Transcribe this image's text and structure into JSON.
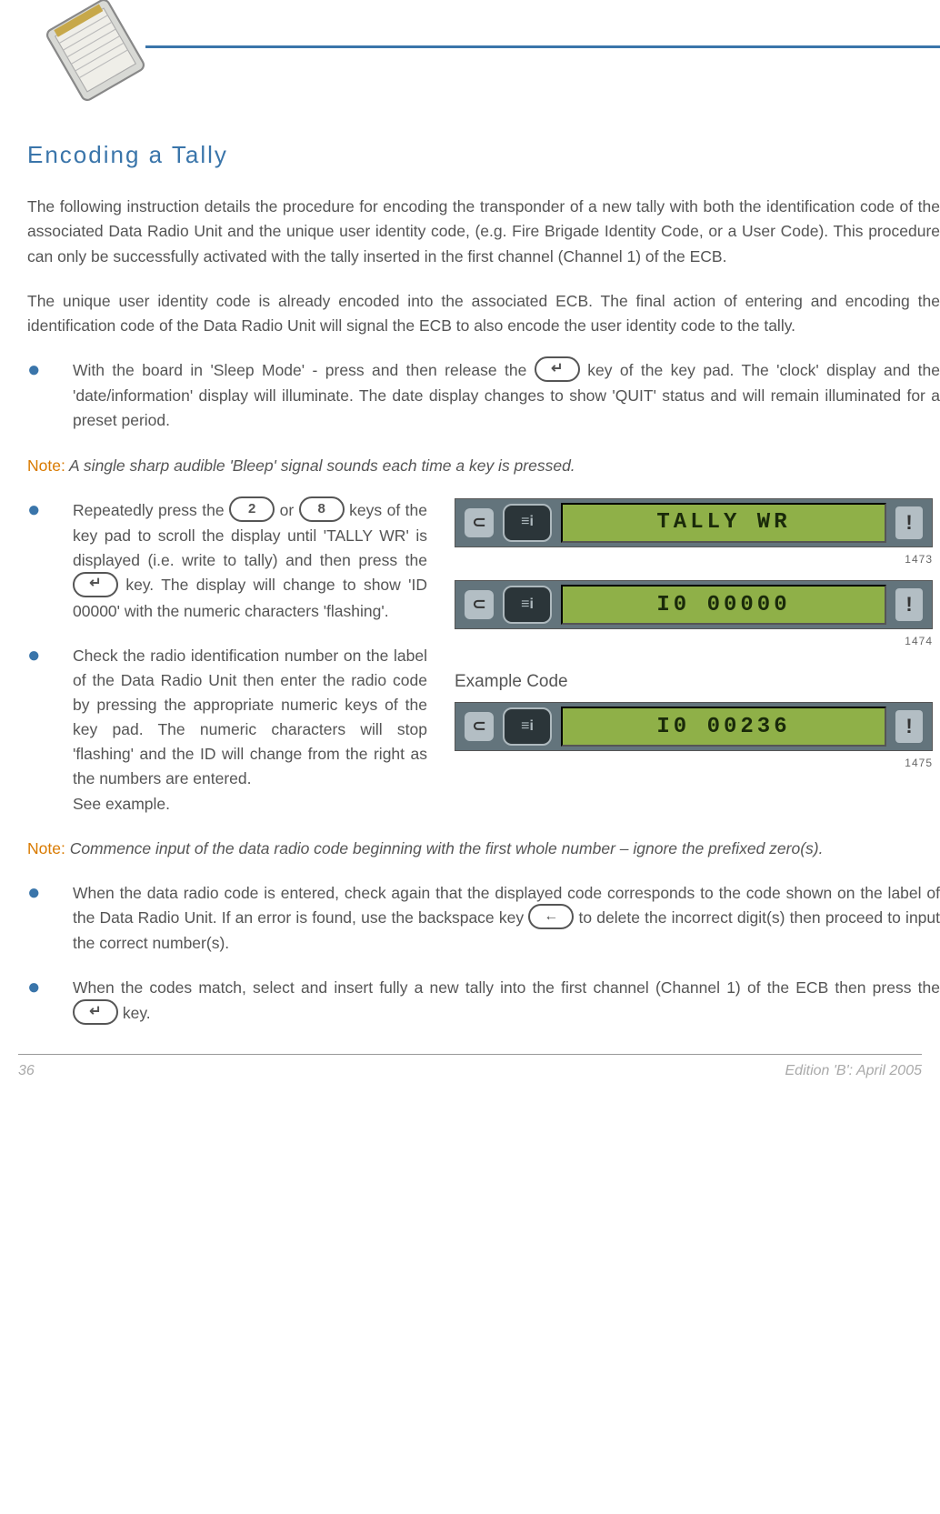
{
  "section_title": "Encoding a Tally",
  "para1": "The following instruction details the procedure for encoding the transponder of a new tally with both the identification code of the associated Data Radio Unit and the unique user identity code, (e.g. Fire Brigade Identity Code, or a User Code).  This procedure can only be successfully activated with the tally inserted in the first channel (Channel 1) of the ECB.",
  "para2": "The unique user identity code is already encoded into the associated ECB.  The final action of entering and encoding the identification code of the Data Radio Unit will signal the ECB to also encode the user identity code to the tally.",
  "bullet1_a": "With the board in 'Sleep Mode' - press and then release the ",
  "bullet1_b": " key of the key pad.  The 'clock' display and the 'date/information' display will illuminate.  The date display changes to show 'QUIT' status and will remain illuminated for a preset period.",
  "note1_label": "Note:",
  "note1_body": " A single sharp audible 'Bleep' signal sounds each time a key is pressed.",
  "bullet2_a": "Repeatedly press the  ",
  "bullet2_b": "  or  ",
  "bullet2_c": "  keys of the key pad to scroll the display until 'TALLY WR' is displayed (i.e. write to tally) and then press the  ",
  "bullet2_d": " key. The  display will change to show 'ID 00000' with the numeric characters 'flashing'.",
  "key_2": "2",
  "key_8": "8",
  "bullet3": "Check the radio identification number on the label of the Data Radio Unit then enter the radio code by pressing the appropriate numeric keys of the key pad.  The numeric characters will stop 'flashing' and the ID will change from the right as the numbers are entered.",
  "bullet3_see": "See example.",
  "lcd1_text": "TALLY WR",
  "lcd2_text": "I0 00000",
  "example_label": "Example Code",
  "lcd3_text": "I0 00236",
  "fig1": "1473",
  "fig2": "1474",
  "fig3": "1475",
  "note2_label": "Note:",
  "note2_body": " Commence input of the data radio code beginning with the first whole number – ignore the prefixed zero(s).",
  "bullet4_a": "When the data radio code is entered, check again that the displayed code corresponds to the code shown on the label of the Data Radio Unit.  If an error is found, use the backspace key ",
  "bullet4_b": "  to delete the incorrect digit(s) then proceed to input the correct number(s).",
  "bullet5_a": "When the codes match, select and insert fully a new tally into the first channel (Channel 1) of the ECB then press the ",
  "bullet5_b": "   key.",
  "page_number": "36",
  "edition": "Edition 'B': April 2005",
  "lcd_btn_light_glyph": "⊂",
  "lcd_btn_dark_glyph": "≡i",
  "lcd_bang_glyph": "!"
}
